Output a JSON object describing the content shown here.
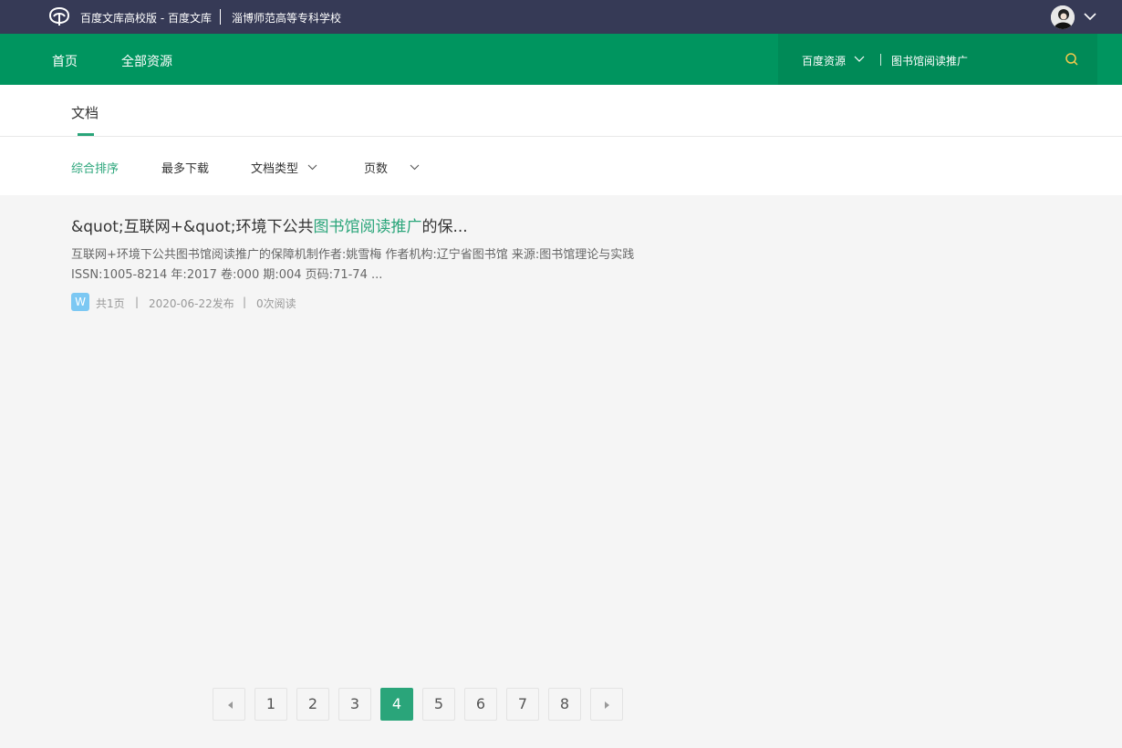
{
  "topbar": {
    "brand": "百度文库高校版 - 百度文库",
    "school": "淄博师范高等专科学校"
  },
  "nav": {
    "home": "首页",
    "all_resources": "全部资源",
    "search_scope": "百度资源",
    "search_query": "图书馆阅读推广"
  },
  "tabs": {
    "doc": "文档"
  },
  "filters": {
    "comprehensive": "综合排序",
    "most_downloads": "最多下载",
    "doc_type": "文档类型",
    "pages": "页数"
  },
  "result": {
    "title_pre": "&quot;互联网+&quot;环境下公共",
    "title_highlight": "图书馆阅读推广",
    "title_post": "的保...",
    "description": "互联网+环境下公共图书馆阅读推广的保障机制作者:姚雪梅 作者机构:辽宁省图书馆 来源:图书馆理论与实践 ISSN:1005-8214 年:2017 卷:000 期:004 页码:71-74 ...",
    "badge": "W",
    "pages": "共1页",
    "sep1": "|",
    "date": "2020-06-22发布",
    "sep2": "|",
    "reads": "0次阅读"
  },
  "pagination": {
    "pages": [
      "1",
      "2",
      "3",
      "4",
      "5",
      "6",
      "7",
      "8"
    ],
    "current": "4"
  },
  "colors": {
    "topbar": "#363a56",
    "nav": "#00955f",
    "accent": "#2aa57a",
    "search_icon": "#f2c94c"
  }
}
